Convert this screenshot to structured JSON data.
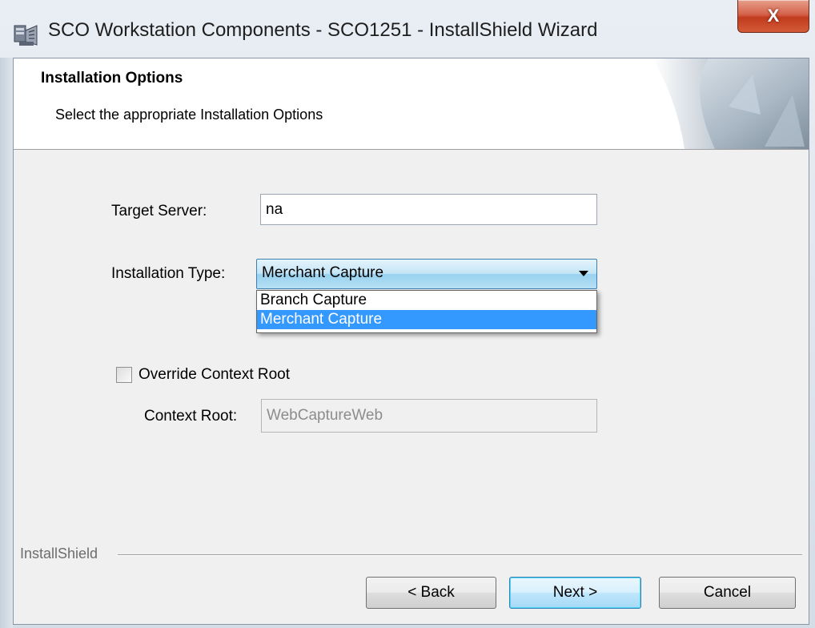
{
  "window": {
    "title": "SCO Workstation Components - SCO1251 - InstallShield Wizard",
    "close_glyph": "X",
    "icon": "installer-icon"
  },
  "banner": {
    "title": "Installation Options",
    "subtitle": "Select the appropriate Installation Options"
  },
  "form": {
    "target_server_label": "Target Server:",
    "target_server_value": "na",
    "installation_type_label": "Installation Type:",
    "installation_type_value": "Merchant Capture",
    "installation_type_options": [
      "Branch Capture",
      "Merchant Capture"
    ],
    "override_label": "Override Context Root",
    "override_checked": false,
    "context_root_label": "Context Root:",
    "context_root_value": "WebCaptureWeb"
  },
  "footer": {
    "brand": "InstallShield",
    "back_label": "< Back",
    "next_label": "Next >",
    "cancel_label": "Cancel"
  },
  "colors": {
    "selection": "#3399ff",
    "close_button": "#c23b1e",
    "combo_border": "#3c7fb1"
  }
}
